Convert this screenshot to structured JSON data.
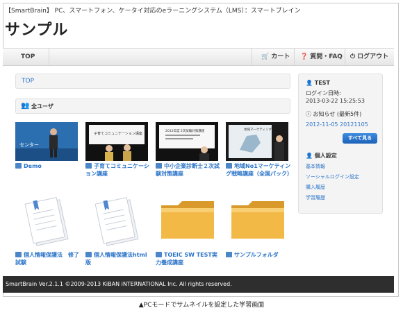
{
  "header": {
    "tagline": "【SmartBrain】 PC、スマートフォン、ケータイ対応のeラーニングシステム（LMS）：スマートブレイン",
    "title": "サンプル"
  },
  "nav": {
    "top": "TOP",
    "cart": "カート",
    "faq": "質問・FAQ",
    "logout": "ログアウト"
  },
  "breadcrumb": "TOP",
  "section_title": "全ユーザ",
  "items": [
    {
      "label": "Demo",
      "thumb": "video-demo"
    },
    {
      "label": "子育てコミュニケーション講座",
      "thumb": "video-childcare"
    },
    {
      "label": "中小企業診断士２次試験対策講座",
      "thumb": "video-consultant"
    },
    {
      "label": "地域No1マーケティング戦略講座（全国パック）",
      "thumb": "video-marketing"
    },
    {
      "label": "個人情報保護法　修了試験",
      "thumb": "document"
    },
    {
      "label": "個人情報保護法html版",
      "thumb": "document"
    },
    {
      "label": "TOEIC SW TEST実力養成講座",
      "thumb": "folder"
    },
    {
      "label": "サンプルフォルダ",
      "thumb": "folder"
    }
  ],
  "thumb_texts": {
    "demo": "センター",
    "childcare": "子育てコミュニケーション講座",
    "consultant": "2012年度 2次試験対策講座",
    "marketing": "地域マーケティング"
  },
  "sidebar": {
    "user": "TEST",
    "login_label": "ログイン日時:",
    "login_time": "2013-03-22 15:25:53",
    "news_title": "お知らせ (最新5件)",
    "news_item": "2012-11-05 20121105",
    "more_button": "すべて見る",
    "personal_title": "個人設定",
    "links": [
      "基本情報",
      "ソーシャルログイン設定",
      "購入履歴",
      "学習履歴"
    ]
  },
  "footer": "SmartBrain Ver.2.1.1 ©2009-2013 KiBAN iNTERNATIONAL Inc. All rights reserved.",
  "caption": "▲PCモードでサムネイルを設定した学習画面",
  "colors": {
    "link": "#2a73c8",
    "footer_bg": "#2e2e2e",
    "button": "#1c62b8"
  }
}
